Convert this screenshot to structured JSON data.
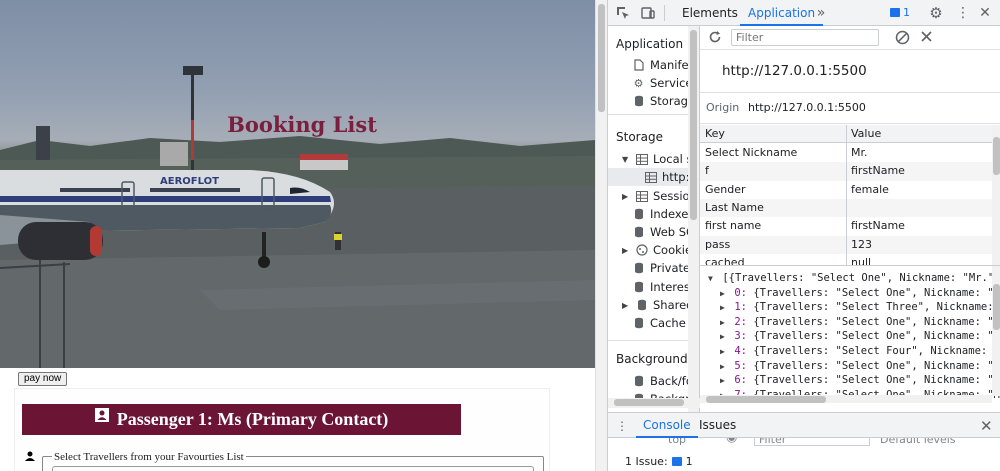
{
  "page": {
    "hero_title": "Booking List",
    "pay_button": "pay now",
    "passenger_header": "Passenger 1: Ms (Primary Contact)",
    "favourites_legend": "Select Travellers from your Favourties List"
  },
  "devtools": {
    "tabs": [
      "Elements",
      "Application"
    ],
    "active_tab": "Application",
    "issues_count": "1",
    "sidebar": {
      "application_header": "Application",
      "application_items": [
        "Manifest",
        "Service",
        "Storage"
      ],
      "storage_header": "Storage",
      "storage_items": [
        "Local st",
        "http:/",
        "Session",
        "Indexed",
        "Web SC",
        "Cookies",
        "Private",
        "Interest",
        "Shared",
        "Cache s"
      ],
      "background_header": "Background se",
      "background_items": [
        "Back/fo",
        "Backgr"
      ]
    },
    "main": {
      "filter_placeholder": "Filter",
      "origin_title": "http://127.0.0.1:5500",
      "origin_label": "Origin",
      "origin_value": "http://127.0.0.1:5500",
      "table_headers": {
        "key": "Key",
        "value": "Value"
      },
      "rows": [
        {
          "key": "Select Nickname",
          "value": "Mr."
        },
        {
          "key": "f",
          "value": "firstName"
        },
        {
          "key": "Gender",
          "value": "female"
        },
        {
          "key": "Last Name",
          "value": ""
        },
        {
          "key": "first name",
          "value": "firstName"
        },
        {
          "key": "pass",
          "value": "123"
        },
        {
          "key": "cached",
          "value": "null"
        }
      ],
      "preview": {
        "root": "[{Travellers: \"Select One\", Nickname: \"Mr.\",",
        "items": [
          {
            "idx": "0",
            "text": "{Travellers: \"Select One\", Nickname: \"Mr"
          },
          {
            "idx": "1",
            "text": "{Travellers: \"Select Three\", Nickname: \""
          },
          {
            "idx": "2",
            "text": "{Travellers: \"Select One\", Nickname: \"Mr"
          },
          {
            "idx": "3",
            "text": "{Travellers: \"Select One\", Nickname: \"Ms"
          },
          {
            "idx": "4",
            "text": "{Travellers: \"Select Four\", Nickname: \"M"
          },
          {
            "idx": "5",
            "text": "{Travellers: \"Select One\", Nickname: \"Mr"
          },
          {
            "idx": "6",
            "text": "{Travellers: \"Select One\", Nickname: \"Mr"
          },
          {
            "idx": "7",
            "text": "{Travellers: \"Select One\", Nickname: \"Mr"
          }
        ]
      }
    },
    "drawer": {
      "tabs": [
        "Console",
        "Issues"
      ],
      "active_tab": "Console",
      "console_top": "top",
      "console_filter": "Filter",
      "console_levels": "Default levels",
      "issue_text": "1 Issue:",
      "issue_count": "1"
    }
  },
  "colors": {
    "accent": "#1a73e8",
    "hero_title": "#7a1f3d",
    "passenger_header_bg": "#6b1433"
  }
}
